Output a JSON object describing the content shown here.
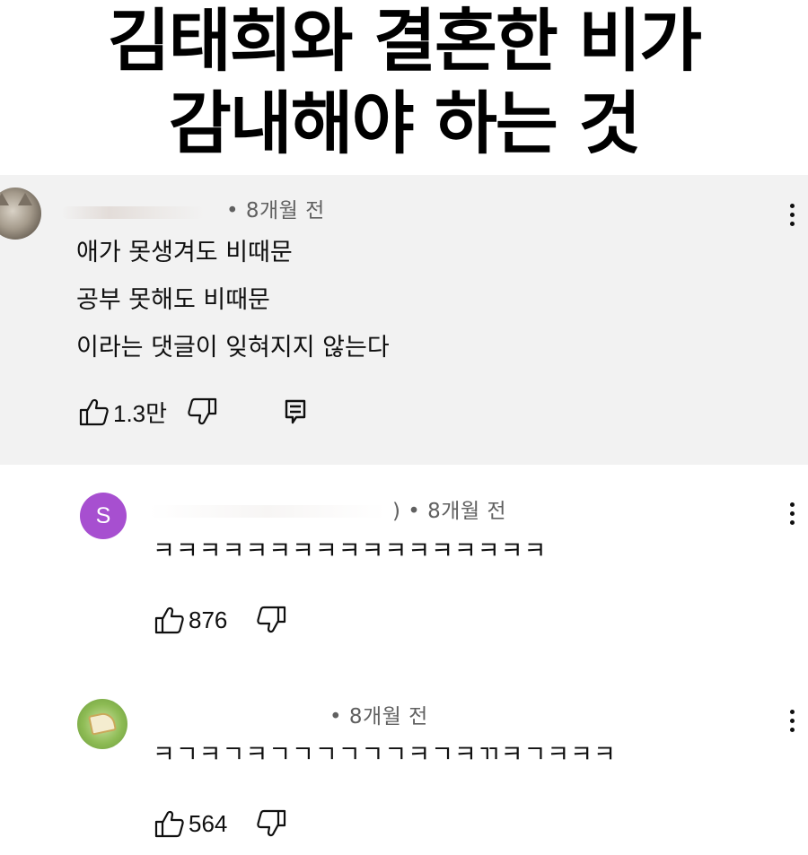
{
  "headline": {
    "line1": "김태희와 결혼한 비가",
    "line2": "감내해야 하는 것"
  },
  "comments": [
    {
      "avatar": "cat-photo",
      "meta": "• 8개월 전",
      "lines": [
        "애가 못생겨도 비때문",
        "공부 못해도 비때문",
        "이라는 댓글이 잊혀지지 않는다"
      ],
      "likes": "1.3만",
      "reply_icon": "reply-icon"
    },
    {
      "avatar_letter": "S",
      "avatar_color": "#a74fd0",
      "meta": ") • 8개월 전",
      "lines": [
        "ㅋㅋㅋㅋㅋㅋㅋㅋㅋㅋㅋㅋㅋㅋㅋㅋㅋ"
      ],
      "likes": "876"
    },
    {
      "avatar": "cake-slice",
      "meta": "• 8개월 전",
      "lines": [
        "ㅋㄱㅋㄱㅋㄱㄱㄱㄱㄱㄱㅋㄱㅋㄲㅋㄱㅋㅋㅋ"
      ],
      "likes": "564"
    }
  ],
  "icons": {
    "like": "thumbs-up-icon",
    "dislike": "thumbs-down-icon",
    "more": "more-vert-icon"
  }
}
